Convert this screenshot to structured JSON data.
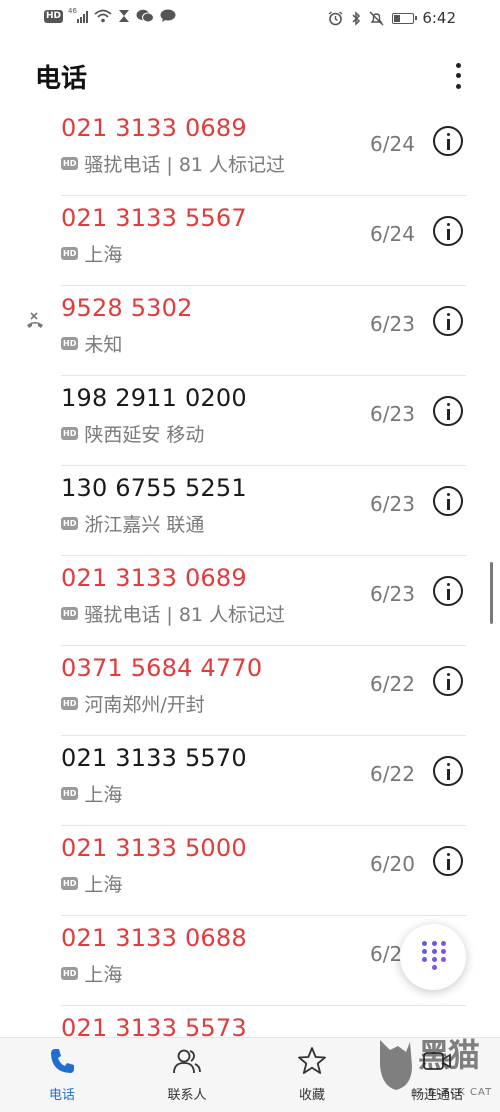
{
  "status_bar": {
    "left_icons": [
      "hd-icon",
      "signal-4g-icon",
      "wifi-icon",
      "hourglass-icon",
      "wechat-icon",
      "message-icon"
    ],
    "network_label": "46",
    "right_icons": [
      "alarm-icon",
      "bluetooth-icon",
      "mute-icon",
      "battery-icon"
    ],
    "battery_level": 0.3,
    "time": "6:42"
  },
  "header": {
    "title": "电话",
    "more_icon": "more-vert-icon"
  },
  "colors": {
    "missed": "#e23b3b",
    "normal": "#1a1a1a",
    "accent": "#1f6fd0"
  },
  "calls": [
    {
      "number": "021 3133 0689",
      "missed": true,
      "label": "骚扰电话 | 81 人标记过",
      "date": "6/24"
    },
    {
      "number": "021 3133 5567",
      "missed": true,
      "label": "上海",
      "date": "6/24"
    },
    {
      "number": "9528 5302",
      "missed": true,
      "rejected": true,
      "label": "未知",
      "date": "6/23"
    },
    {
      "number": "198 2911 0200",
      "missed": false,
      "label": "陕西延安 移动",
      "date": "6/23"
    },
    {
      "number": "130 6755 5251",
      "missed": false,
      "label": "浙江嘉兴 联通",
      "date": "6/23"
    },
    {
      "number": "021 3133 0689",
      "missed": true,
      "label": "骚扰电话 | 81 人标记过",
      "date": "6/23"
    },
    {
      "number": "0371 5684 4770",
      "missed": true,
      "label": "河南郑州/开封",
      "date": "6/22"
    },
    {
      "number": "021 3133 5570",
      "missed": false,
      "label": "上海",
      "date": "6/22"
    },
    {
      "number": "021 3133 5000",
      "missed": true,
      "label": "上海",
      "date": "6/20"
    },
    {
      "number": "021 3133 0688",
      "missed": true,
      "label": "上海",
      "date": "6/2"
    },
    {
      "number": "021 3133 5573",
      "missed": true,
      "label": "",
      "date": ""
    }
  ],
  "hd_badge": "HD",
  "bottom_nav": {
    "tabs": [
      {
        "label": "电话",
        "icon": "phone-icon",
        "active": true
      },
      {
        "label": "联系人",
        "icon": "contacts-icon",
        "active": false
      },
      {
        "label": "收藏",
        "icon": "star-icon",
        "active": false
      },
      {
        "label": "畅连通话",
        "icon": "video-call-icon",
        "active": false
      }
    ]
  },
  "watermark": {
    "text_cn": "黑猫",
    "text_en": "BLACK CAT"
  }
}
